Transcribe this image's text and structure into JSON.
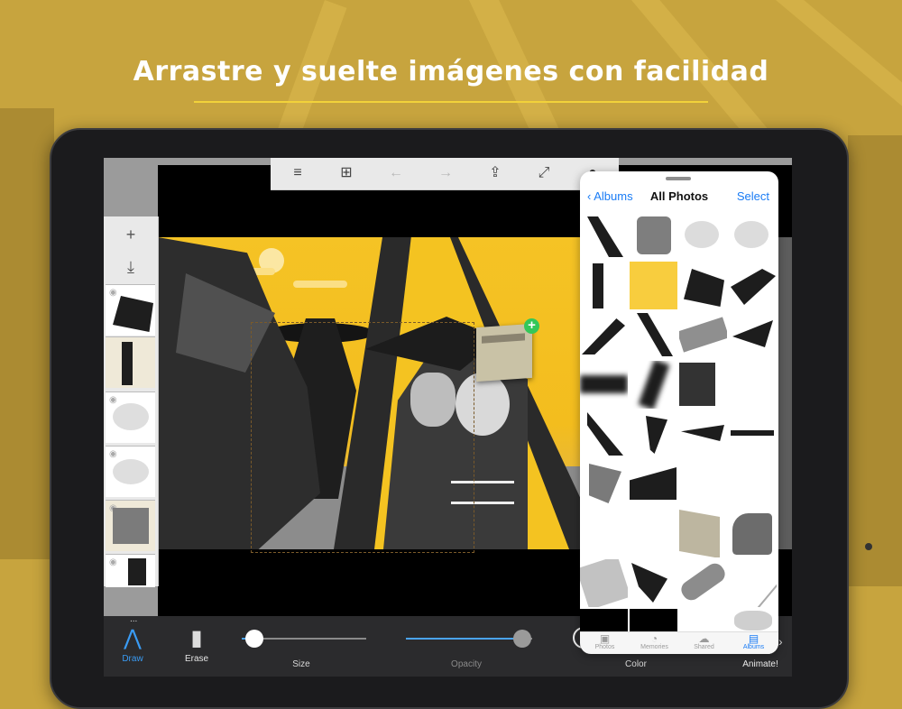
{
  "headline": "Arrastre y suelte imágenes con facilidad",
  "toolbar": {
    "menu_icon": "≡",
    "add_frame_icon": "⊞",
    "undo_icon": "←",
    "redo_icon": "→",
    "share_icon": "⇪",
    "fullscreen_icon": "⤢",
    "info_icon": "●"
  },
  "layers": {
    "add_icon": "+",
    "import_icon": "⤓",
    "eye_icon": "◉"
  },
  "photos": {
    "back_label": "Albums",
    "back_icon": "‹",
    "title": "All Photos",
    "select_label": "Select",
    "tabs": [
      {
        "label": "Photos",
        "icon": "▣",
        "active": false
      },
      {
        "label": "Memories",
        "icon": "◔",
        "active": false
      },
      {
        "label": "Shared",
        "icon": "☁",
        "active": false
      },
      {
        "label": "Albums",
        "icon": "▤",
        "active": true
      }
    ]
  },
  "bottom_bar": {
    "more_icon": "...",
    "draw_label": "Draw",
    "draw_icon": "⋀",
    "erase_label": "Erase",
    "erase_icon": "▮",
    "size_label": "Size",
    "size_value": 0.1,
    "opacity_label": "Opacity",
    "opacity_value": 0.92,
    "color_label": "Color",
    "animate_label": "Animate!",
    "next_icon": "›"
  },
  "drag": {
    "plus_icon": "+"
  },
  "colors": {
    "accent": "#1a7cf5",
    "highlight_yellow": "#f8cd3e",
    "plus_green": "#34c759",
    "background": "#c7a43e"
  }
}
